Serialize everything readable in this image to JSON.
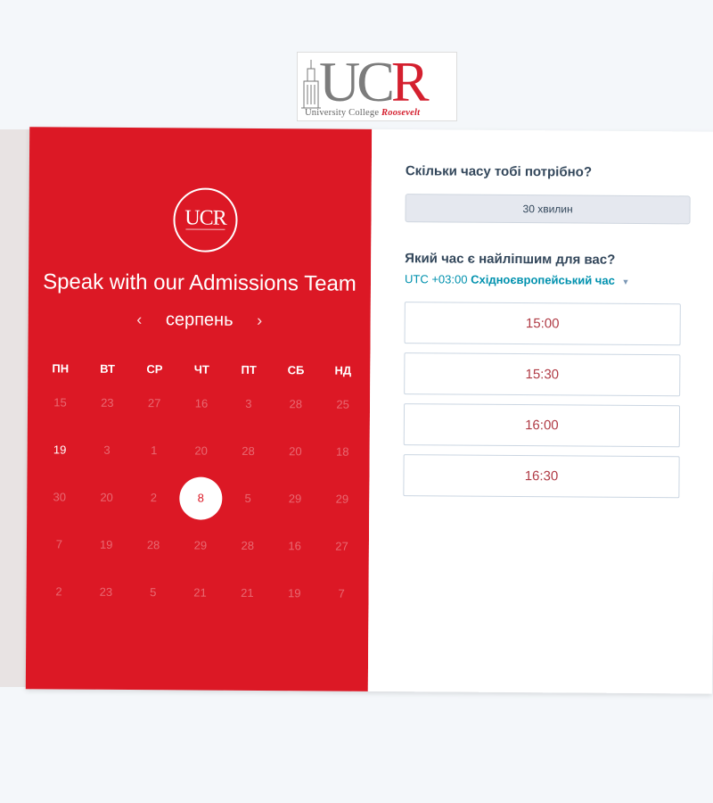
{
  "logo": {
    "letters_uc": "UC",
    "letters_r": "R",
    "subtitle_main": "University College",
    "subtitle_accent": "Roosevelt",
    "circle_letters": "UCR"
  },
  "calendar": {
    "heading": "Speak with our Admissions Team",
    "month": "серпень",
    "prev_icon": "‹",
    "next_icon": "›",
    "weekdays": [
      "ПН",
      "ВТ",
      "СР",
      "ЧТ",
      "ПТ",
      "СБ",
      "НД"
    ],
    "weeks": [
      [
        "15",
        "23",
        "27",
        "16",
        "3",
        "28",
        "25"
      ],
      [
        "19",
        "3",
        "1",
        "20",
        "28",
        "20",
        "18"
      ],
      [
        "30",
        "20",
        "2",
        "8",
        "5",
        "29",
        "29"
      ],
      [
        "7",
        "19",
        "28",
        "29",
        "28",
        "16",
        "27"
      ],
      [
        "2",
        "23",
        "5",
        "21",
        "21",
        "19",
        "7"
      ]
    ],
    "available_day": "19",
    "selected_day": "8"
  },
  "booking": {
    "duration_question": "Скільки часу тобі потрібно?",
    "duration_value": "30 хвилин",
    "time_question": "Який час є найліпшим для вас?",
    "timezone_offset": "UTC +03:00",
    "timezone_name": "Східноєвропейський час",
    "slots": [
      "15:00",
      "15:30",
      "16:00",
      "16:30"
    ]
  },
  "colors": {
    "brand_red": "#dc1825",
    "text_dark": "#33475b",
    "link_teal": "#0091ae",
    "slot_text": "#b03b45"
  }
}
